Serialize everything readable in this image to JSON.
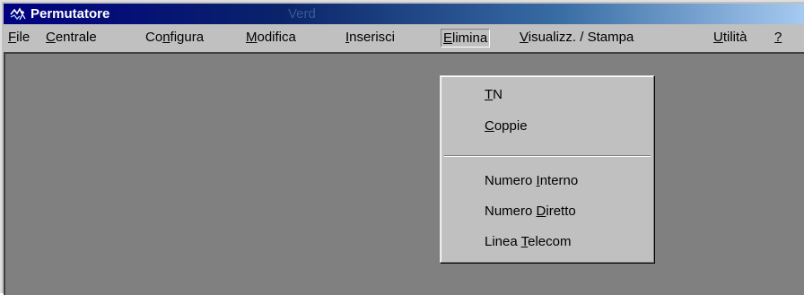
{
  "window": {
    "title": "Permutatore",
    "title_ghost": "Verd",
    "title_icon": "app-wire-icon"
  },
  "menubar": {
    "items": [
      {
        "before": "",
        "accel": "F",
        "after": "ile"
      },
      {
        "before": "",
        "accel": "C",
        "after": "entrale"
      },
      {
        "before": "Co",
        "accel": "n",
        "after": "figura"
      },
      {
        "before": "",
        "accel": "M",
        "after": "odifica"
      },
      {
        "before": "",
        "accel": "I",
        "after": "nserisci"
      },
      {
        "before": "",
        "accel": "E",
        "after": "limina"
      },
      {
        "before": "",
        "accel": "V",
        "after": "isualizz. / Stampa"
      },
      {
        "before": "",
        "accel": "U",
        "after": "tilità"
      },
      {
        "before": "",
        "accel": "?",
        "after": ""
      }
    ],
    "open_item": "Elimina"
  },
  "dropdown": {
    "items": [
      {
        "before": "",
        "accel": "T",
        "after": "N"
      },
      {
        "before": "",
        "accel": "C",
        "after": "oppie"
      },
      {
        "before": "Numero ",
        "accel": "I",
        "after": "nterno"
      },
      {
        "before": "Numero ",
        "accel": "D",
        "after": "iretto"
      },
      {
        "before": "Linea ",
        "accel": "T",
        "after": "elecom"
      }
    ]
  },
  "colors": {
    "titlebar_start": "#000080",
    "titlebar_end": "#a6caf0",
    "face": "#c0c0c0",
    "client": "#808080"
  }
}
